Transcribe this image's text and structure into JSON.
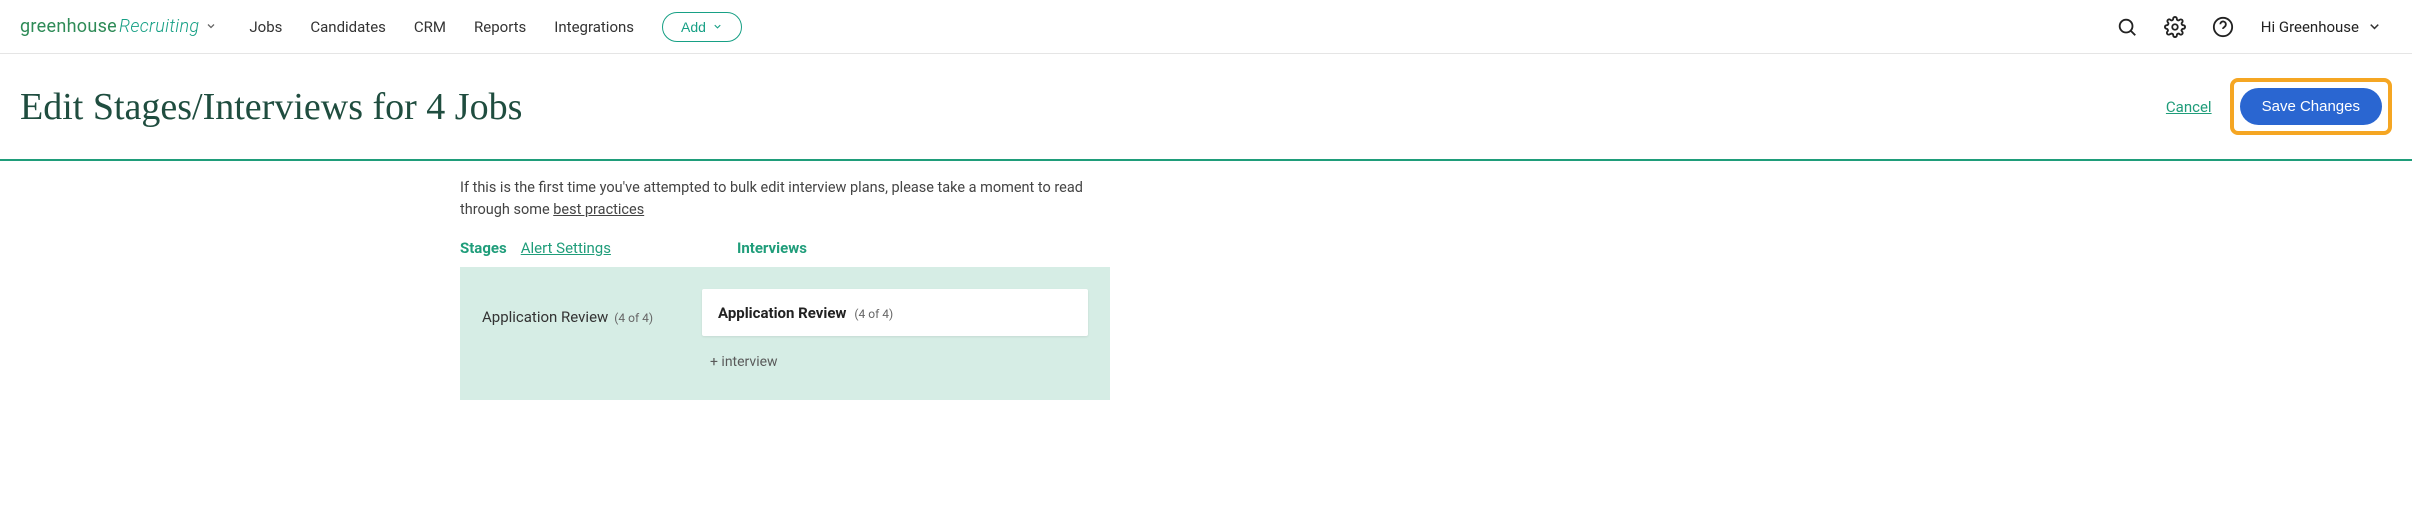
{
  "brand": {
    "part1": "greenhouse",
    "part2": "Recruiting"
  },
  "nav": {
    "jobs": "Jobs",
    "candidates": "Candidates",
    "crm": "CRM",
    "reports": "Reports",
    "integrations": "Integrations",
    "add": "Add"
  },
  "user": {
    "greeting": "Hi Greenhouse"
  },
  "header": {
    "title": "Edit Stages/Interviews for 4 Jobs",
    "cancel": "Cancel",
    "save": "Save Changes"
  },
  "intro": {
    "text_before": "If this is the first time you've attempted to bulk edit interview plans, please take a moment to read through some ",
    "link": "best practices"
  },
  "tabs": {
    "stages": "Stages",
    "alert": "Alert Settings",
    "interviews": "Interviews"
  },
  "stage": {
    "name": "Application Review",
    "count": "(4 of 4)"
  },
  "interview": {
    "name": "Application Review",
    "count": "(4 of 4)",
    "add": "+ interview"
  }
}
